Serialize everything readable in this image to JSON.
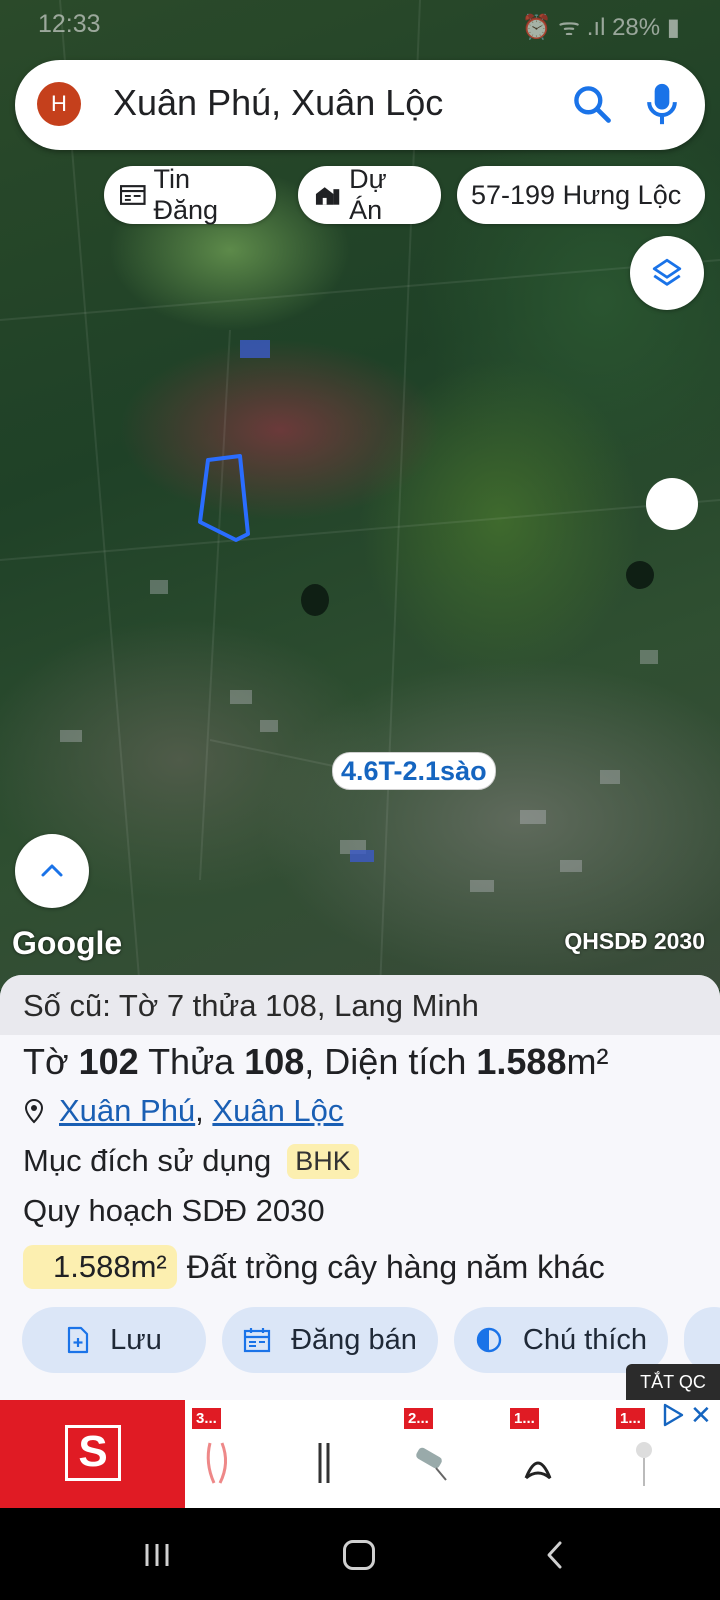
{
  "status_bar": {
    "time": "12:33",
    "right": "⏰ ᯤ .ıl 28% ▮"
  },
  "search": {
    "avatar_letter": "H",
    "query": "Xuân Phú, Xuân Lộc"
  },
  "chips": [
    {
      "label": "Tin Đăng",
      "icon": "listing-icon"
    },
    {
      "label": "Dự Án",
      "icon": "project-icon"
    },
    {
      "label": "57-199 Hưng Lộc",
      "icon": ""
    }
  ],
  "map": {
    "price_label": "4.6T-2.1sào",
    "attribution": "Google",
    "layer_name": "QHSDĐ 2030"
  },
  "parcel": {
    "old_info": "Số cũ: Tờ 7 thửa 108, Lang Minh",
    "to_label": "Tờ",
    "to_value": "102",
    "thua_label": "Thửa",
    "thua_value": "108",
    "area_label": ", Diện tích",
    "area_value": "1.588",
    "area_unit": "m²",
    "commune": "Xuân Phú",
    "district": "Xuân Lộc",
    "purpose_label": "Mục đích sử dụng",
    "purpose_code": "BHK",
    "plan_label": "Quy hoạch SDĐ 2030",
    "plan_area": "1.588m²",
    "plan_description": "Đất trồng cây hàng năm khác"
  },
  "actions": [
    {
      "label": "Lưu",
      "icon": "save-icon"
    },
    {
      "label": "Đăng bán",
      "icon": "post-sale-icon"
    },
    {
      "label": "Chú thích",
      "icon": "legend-icon"
    }
  ],
  "ad": {
    "close_label": "TẮT QC",
    "logo_letter": "S",
    "products": [
      "3...",
      "",
      "2...",
      "1...",
      "1..."
    ]
  },
  "colors": {
    "accent": "#1a73e8",
    "badge": "#fcefb0",
    "action_bg": "#dbe6f7",
    "avatar": "#c5401c"
  }
}
